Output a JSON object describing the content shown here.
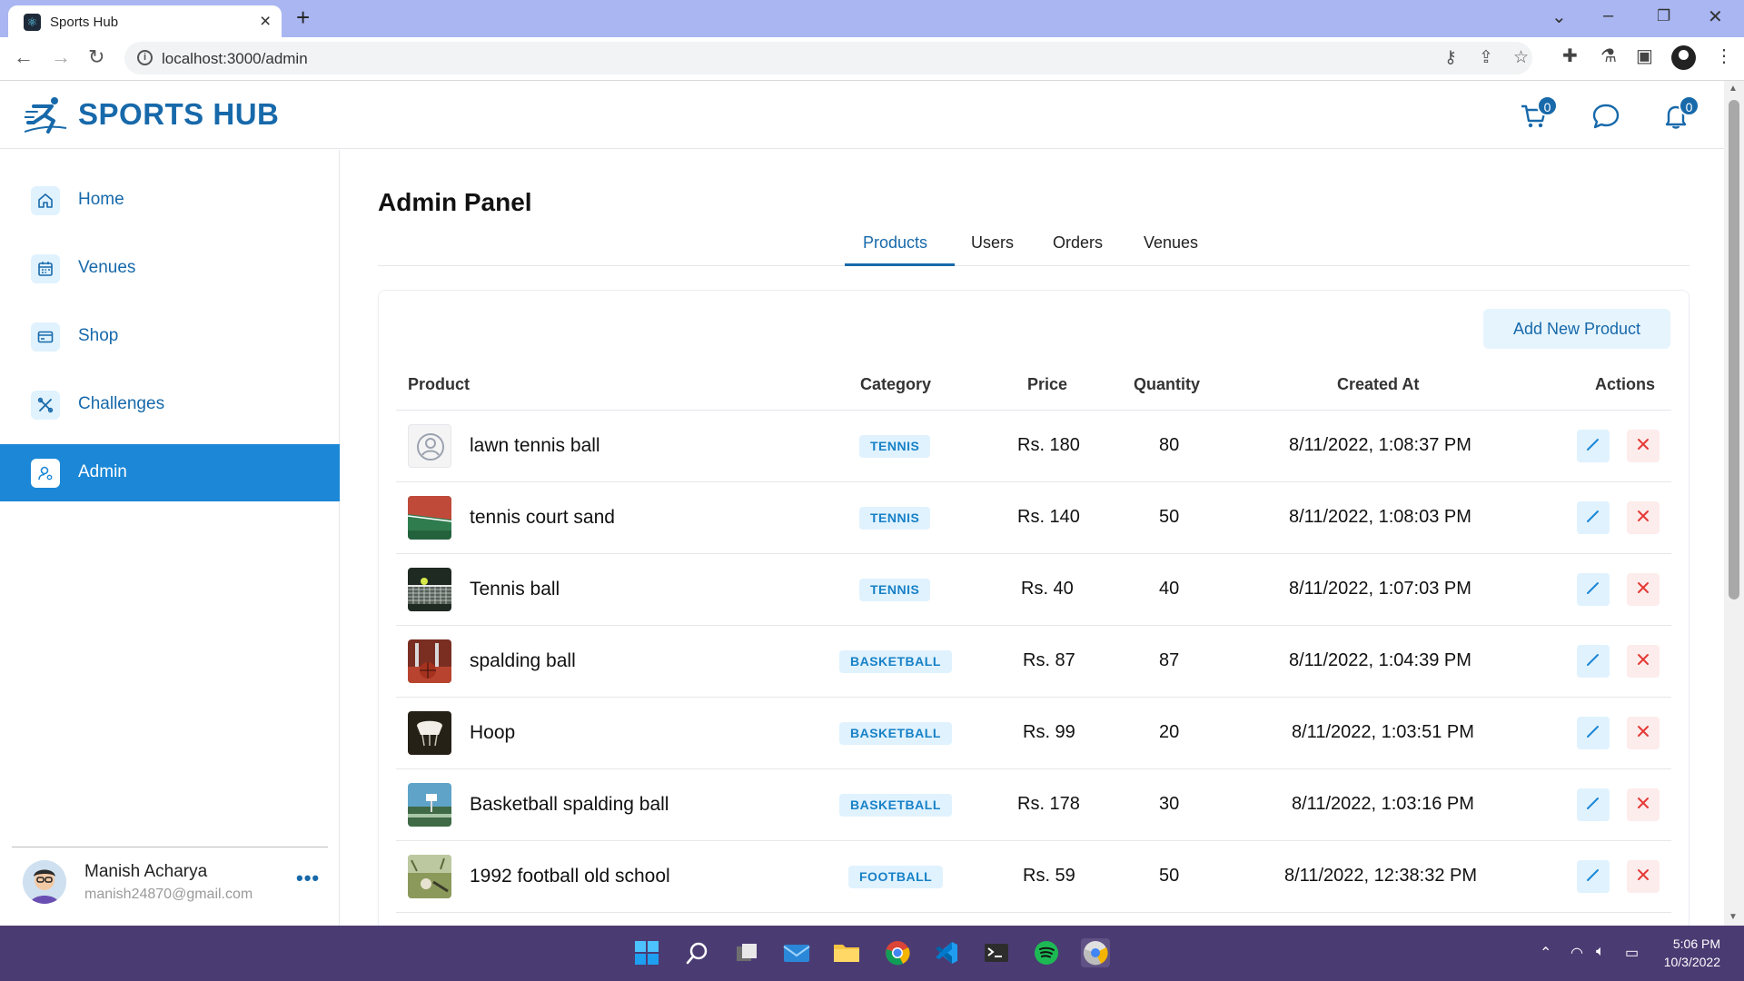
{
  "browser": {
    "tab_title": "Sports Hub",
    "url": "localhost:3000/admin"
  },
  "header": {
    "logo_text": "SPORTS HUB",
    "cart_count": "0",
    "notification_count": "0"
  },
  "sidebar": {
    "items": [
      {
        "label": "Home",
        "icon": "home-icon"
      },
      {
        "label": "Venues",
        "icon": "calendar-icon"
      },
      {
        "label": "Shop",
        "icon": "card-icon"
      },
      {
        "label": "Challenges",
        "icon": "tools-icon"
      },
      {
        "label": "Admin",
        "icon": "admin-user-icon",
        "active": true
      }
    ],
    "user": {
      "name": "Manish Acharya",
      "email": "manish24870@gmail.com",
      "more": "•••"
    }
  },
  "main": {
    "title": "Admin Panel",
    "tabs": [
      {
        "label": "Products",
        "active": true
      },
      {
        "label": "Users"
      },
      {
        "label": "Orders"
      },
      {
        "label": "Venues"
      }
    ],
    "add_button": "Add New Product",
    "columns": [
      "Product",
      "Category",
      "Price",
      "Quantity",
      "Created At",
      "Actions"
    ],
    "rows": [
      {
        "name": "lawn tennis ball",
        "category": "TENNIS",
        "price": "Rs. 180",
        "quantity": "80",
        "created": "8/11/2022, 1:08:37 PM",
        "thumb": "placeholder"
      },
      {
        "name": "tennis court sand",
        "category": "TENNIS",
        "price": "Rs. 140",
        "quantity": "50",
        "created": "8/11/2022, 1:08:03 PM",
        "thumb": "court"
      },
      {
        "name": "Tennis ball",
        "category": "TENNIS",
        "price": "Rs. 40",
        "quantity": "40",
        "created": "8/11/2022, 1:07:03 PM",
        "thumb": "net"
      },
      {
        "name": "spalding ball",
        "category": "BASKETBALL",
        "price": "Rs. 87",
        "quantity": "87",
        "created": "8/11/2022, 1:04:39 PM",
        "thumb": "redball"
      },
      {
        "name": "Hoop",
        "category": "BASKETBALL",
        "price": "Rs. 99",
        "quantity": "20",
        "created": "8/11/2022, 1:03:51 PM",
        "thumb": "hoop"
      },
      {
        "name": "Basketball spalding ball",
        "category": "BASKETBALL",
        "price": "Rs. 178",
        "quantity": "30",
        "created": "8/11/2022, 1:03:16 PM",
        "thumb": "outdoor"
      },
      {
        "name": "1992 football old school",
        "category": "FOOTBALL",
        "price": "Rs. 59",
        "quantity": "50",
        "created": "8/11/2022, 12:38:32 PM",
        "thumb": "field"
      }
    ]
  },
  "taskbar": {
    "time": "5:06 PM",
    "date": "10/3/2022"
  },
  "colors": {
    "brand": "#1769aa",
    "active_nav": "#1b87d6",
    "badge_bg": "#e0f2fe",
    "delete": "#e53935",
    "taskbar": "#4b3b73",
    "tabstrip": "#a9b6f2"
  }
}
